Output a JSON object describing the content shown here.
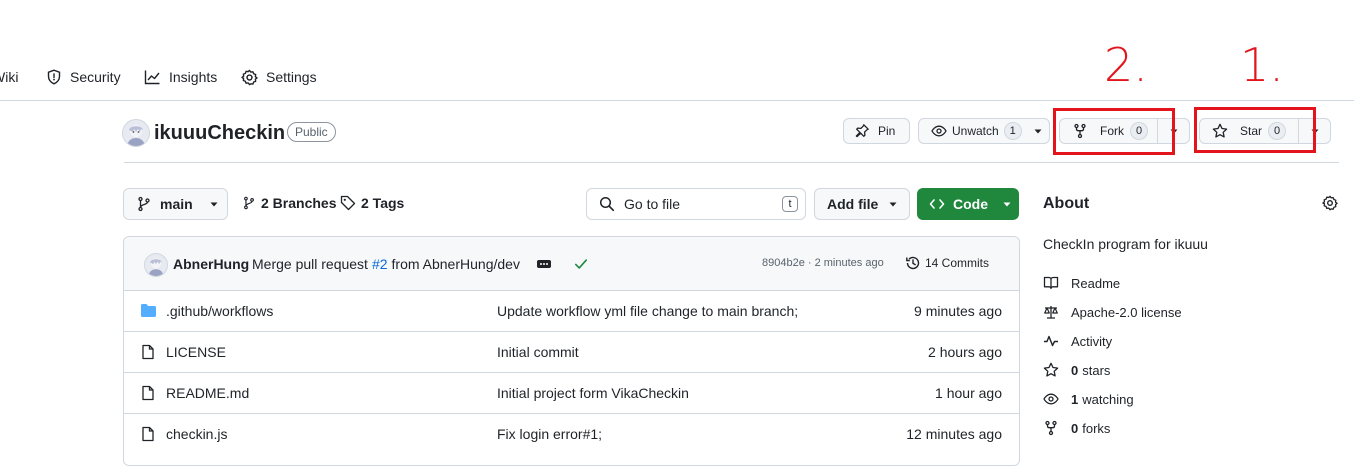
{
  "nav": {
    "wiki": "Wiki",
    "security": "Security",
    "insights": "Insights",
    "settings": "Settings"
  },
  "repo": {
    "name": "ikuuuCheckin",
    "visibility": "Public"
  },
  "actions": {
    "pin": "Pin",
    "unwatch": "Unwatch",
    "unwatch_count": "1",
    "fork": "Fork",
    "fork_count": "0",
    "star": "Star",
    "star_count": "0"
  },
  "annotations": {
    "fork_mark": "2.",
    "star_mark": "1.",
    "color": "#e3141b"
  },
  "toolbar": {
    "branch": "main",
    "branches": "2 Branches",
    "tags": "2 Tags",
    "search_placeholder": "Go to file",
    "search_shortcut": "t",
    "add_file": "Add file",
    "code": "Code"
  },
  "commit": {
    "author": "AbnerHung",
    "message_prefix": "Merge pull request",
    "pr_link": "#2",
    "message_suffix": "from AbnerHung/dev",
    "hash_time": "8904b2e · 2 minutes ago",
    "commits": "14 Commits"
  },
  "files": [
    {
      "name": ".github/workflows",
      "type": "folder",
      "message": "Update workflow yml file change to main branch;",
      "time": "9 minutes ago"
    },
    {
      "name": "LICENSE",
      "type": "file",
      "message": "Initial commit",
      "time": "2 hours ago"
    },
    {
      "name": "README.md",
      "type": "file",
      "message": "Initial project form VikaCheckin",
      "time": "1 hour ago"
    },
    {
      "name": "checkin.js",
      "type": "file",
      "message": "Fix login error#1;",
      "time": "12 minutes ago"
    }
  ],
  "about": {
    "heading": "About",
    "description": "CheckIn program for ikuuu",
    "readme": "Readme",
    "license": "Apache-2.0 license",
    "activity": "Activity",
    "stars_count": "0",
    "stars_label": "stars",
    "watching_count": "1",
    "watching_label": "watching",
    "forks_count": "0",
    "forks_label": "forks"
  },
  "colors": {
    "accent_green": "#1f883d",
    "link_blue": "#0969da",
    "folder_blue": "#54aeff"
  }
}
